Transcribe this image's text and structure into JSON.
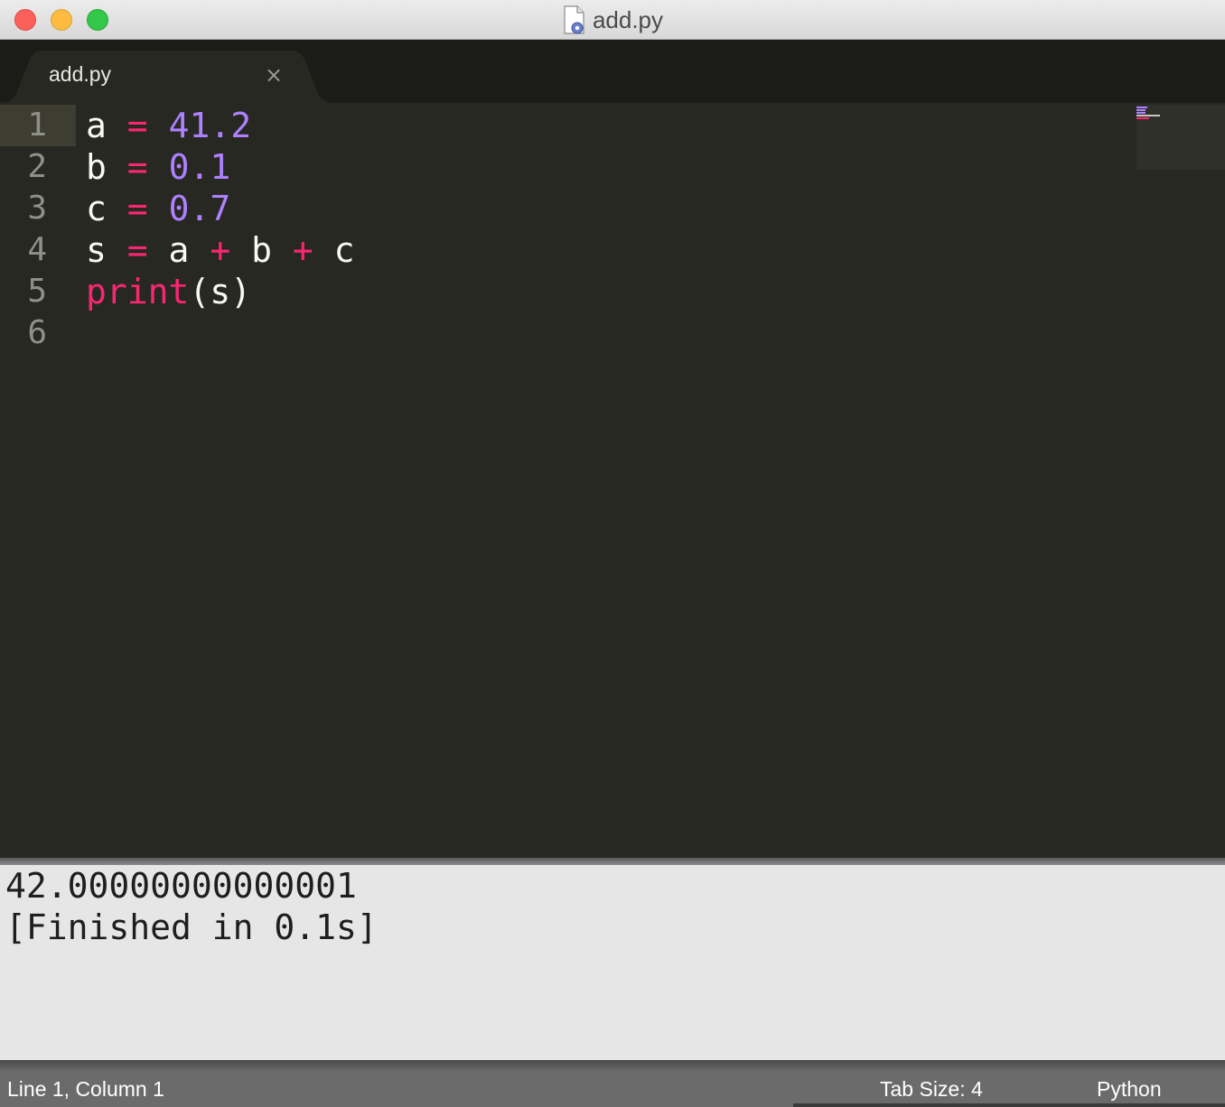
{
  "window": {
    "title": "add.py",
    "title_icon": "python-file-icon"
  },
  "tabs": [
    {
      "label": "add.py",
      "close_icon": "close-icon",
      "active": true
    }
  ],
  "tab_close_glyph": "×",
  "editor": {
    "current_line": 1,
    "line_numbers": [
      "1",
      "2",
      "3",
      "4",
      "5",
      "6"
    ],
    "lines": [
      [
        {
          "t": "a",
          "k": "var"
        },
        {
          "t": " ",
          "k": "var"
        },
        {
          "t": "=",
          "k": "op"
        },
        {
          "t": " ",
          "k": "var"
        },
        {
          "t": "41.2",
          "k": "num"
        }
      ],
      [
        {
          "t": "b",
          "k": "var"
        },
        {
          "t": " ",
          "k": "var"
        },
        {
          "t": "=",
          "k": "op"
        },
        {
          "t": " ",
          "k": "var"
        },
        {
          "t": "0.1",
          "k": "num"
        }
      ],
      [
        {
          "t": "c",
          "k": "var"
        },
        {
          "t": " ",
          "k": "var"
        },
        {
          "t": "=",
          "k": "op"
        },
        {
          "t": " ",
          "k": "var"
        },
        {
          "t": "0.7",
          "k": "num"
        }
      ],
      [
        {
          "t": "s",
          "k": "var"
        },
        {
          "t": " ",
          "k": "var"
        },
        {
          "t": "=",
          "k": "op"
        },
        {
          "t": " a ",
          "k": "var"
        },
        {
          "t": "+",
          "k": "op"
        },
        {
          "t": " b ",
          "k": "var"
        },
        {
          "t": "+",
          "k": "op"
        },
        {
          "t": " c",
          "k": "var"
        }
      ],
      [
        {
          "t": "print",
          "k": "func"
        },
        {
          "t": "(s)",
          "k": "punc"
        }
      ],
      []
    ]
  },
  "output": {
    "lines": [
      "42.00000000000001",
      "[Finished in 0.1s]"
    ]
  },
  "statusbar": {
    "position": "Line 1, Column 1",
    "tab_size": "Tab Size: 4",
    "syntax": "Python"
  },
  "colors": {
    "editor_bg": "#272822",
    "keyword": "#f92672",
    "number": "#ae81ff",
    "text": "#f8f8f2",
    "line_number": "#90908a",
    "output_bg": "#e6e6e6"
  }
}
